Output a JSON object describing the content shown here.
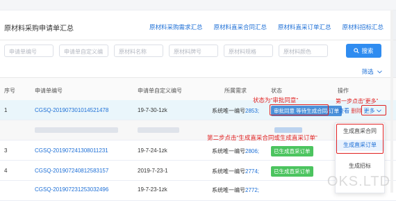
{
  "page": {
    "title": "原材料采购申请单汇总",
    "top_links": [
      "原材料采购需求汇总",
      "原材料直采合同汇总",
      "原材料直采订单汇总",
      "原材料招标汇总"
    ]
  },
  "filters": {
    "placeholders": [
      "申请单编号",
      "申请单自定义编",
      "原材料名称",
      "原材料牌号",
      "原材料规格",
      "原材料颜色"
    ],
    "search_label": "搜索",
    "filter_toggle": "筛选"
  },
  "table": {
    "headers": [
      "序号",
      "申请单编号",
      "申请单自定义编号",
      "所属需求",
      "状态",
      "操作"
    ],
    "sys_prefix": "系统唯一编号",
    "rows": [
      {
        "idx": "1",
        "code": "CGSQ-201907301014521478",
        "custom": "19-7-30-1zk",
        "sys": "2853;",
        "status": "审批同意 等待生成合同/订单"
      },
      {
        "idx": "3",
        "code": "CGSQ-201907241308011231",
        "custom": "19-7-24-1zk",
        "sys": "2806;",
        "status": "已生成直采订单"
      },
      {
        "idx": "4",
        "code": "CGSQ-201907240812583157",
        "custom": "2019-7-23-1",
        "sys": "2774;",
        "status": "已生成直采订单"
      },
      {
        "idx": "",
        "code": "CGSQ-201907231253032496",
        "custom": "19-7-23-1zk",
        "sys": "2772;",
        "status": ""
      }
    ],
    "actions": {
      "view": "查看",
      "del": "删除",
      "more": "更多"
    }
  },
  "dropdown": {
    "items": [
      "生成直采合同",
      "生成直采订单",
      "生成招标"
    ]
  },
  "annotations": {
    "status": "状态为“审批同意”",
    "step1": "第一步点击“更多”",
    "step2": "第二步点击“生成直采合同或生成直采订单”"
  },
  "watermark": "OKS.LTD",
  "icons": {
    "search": "search-icon",
    "chevron": "chevron-down-icon"
  }
}
